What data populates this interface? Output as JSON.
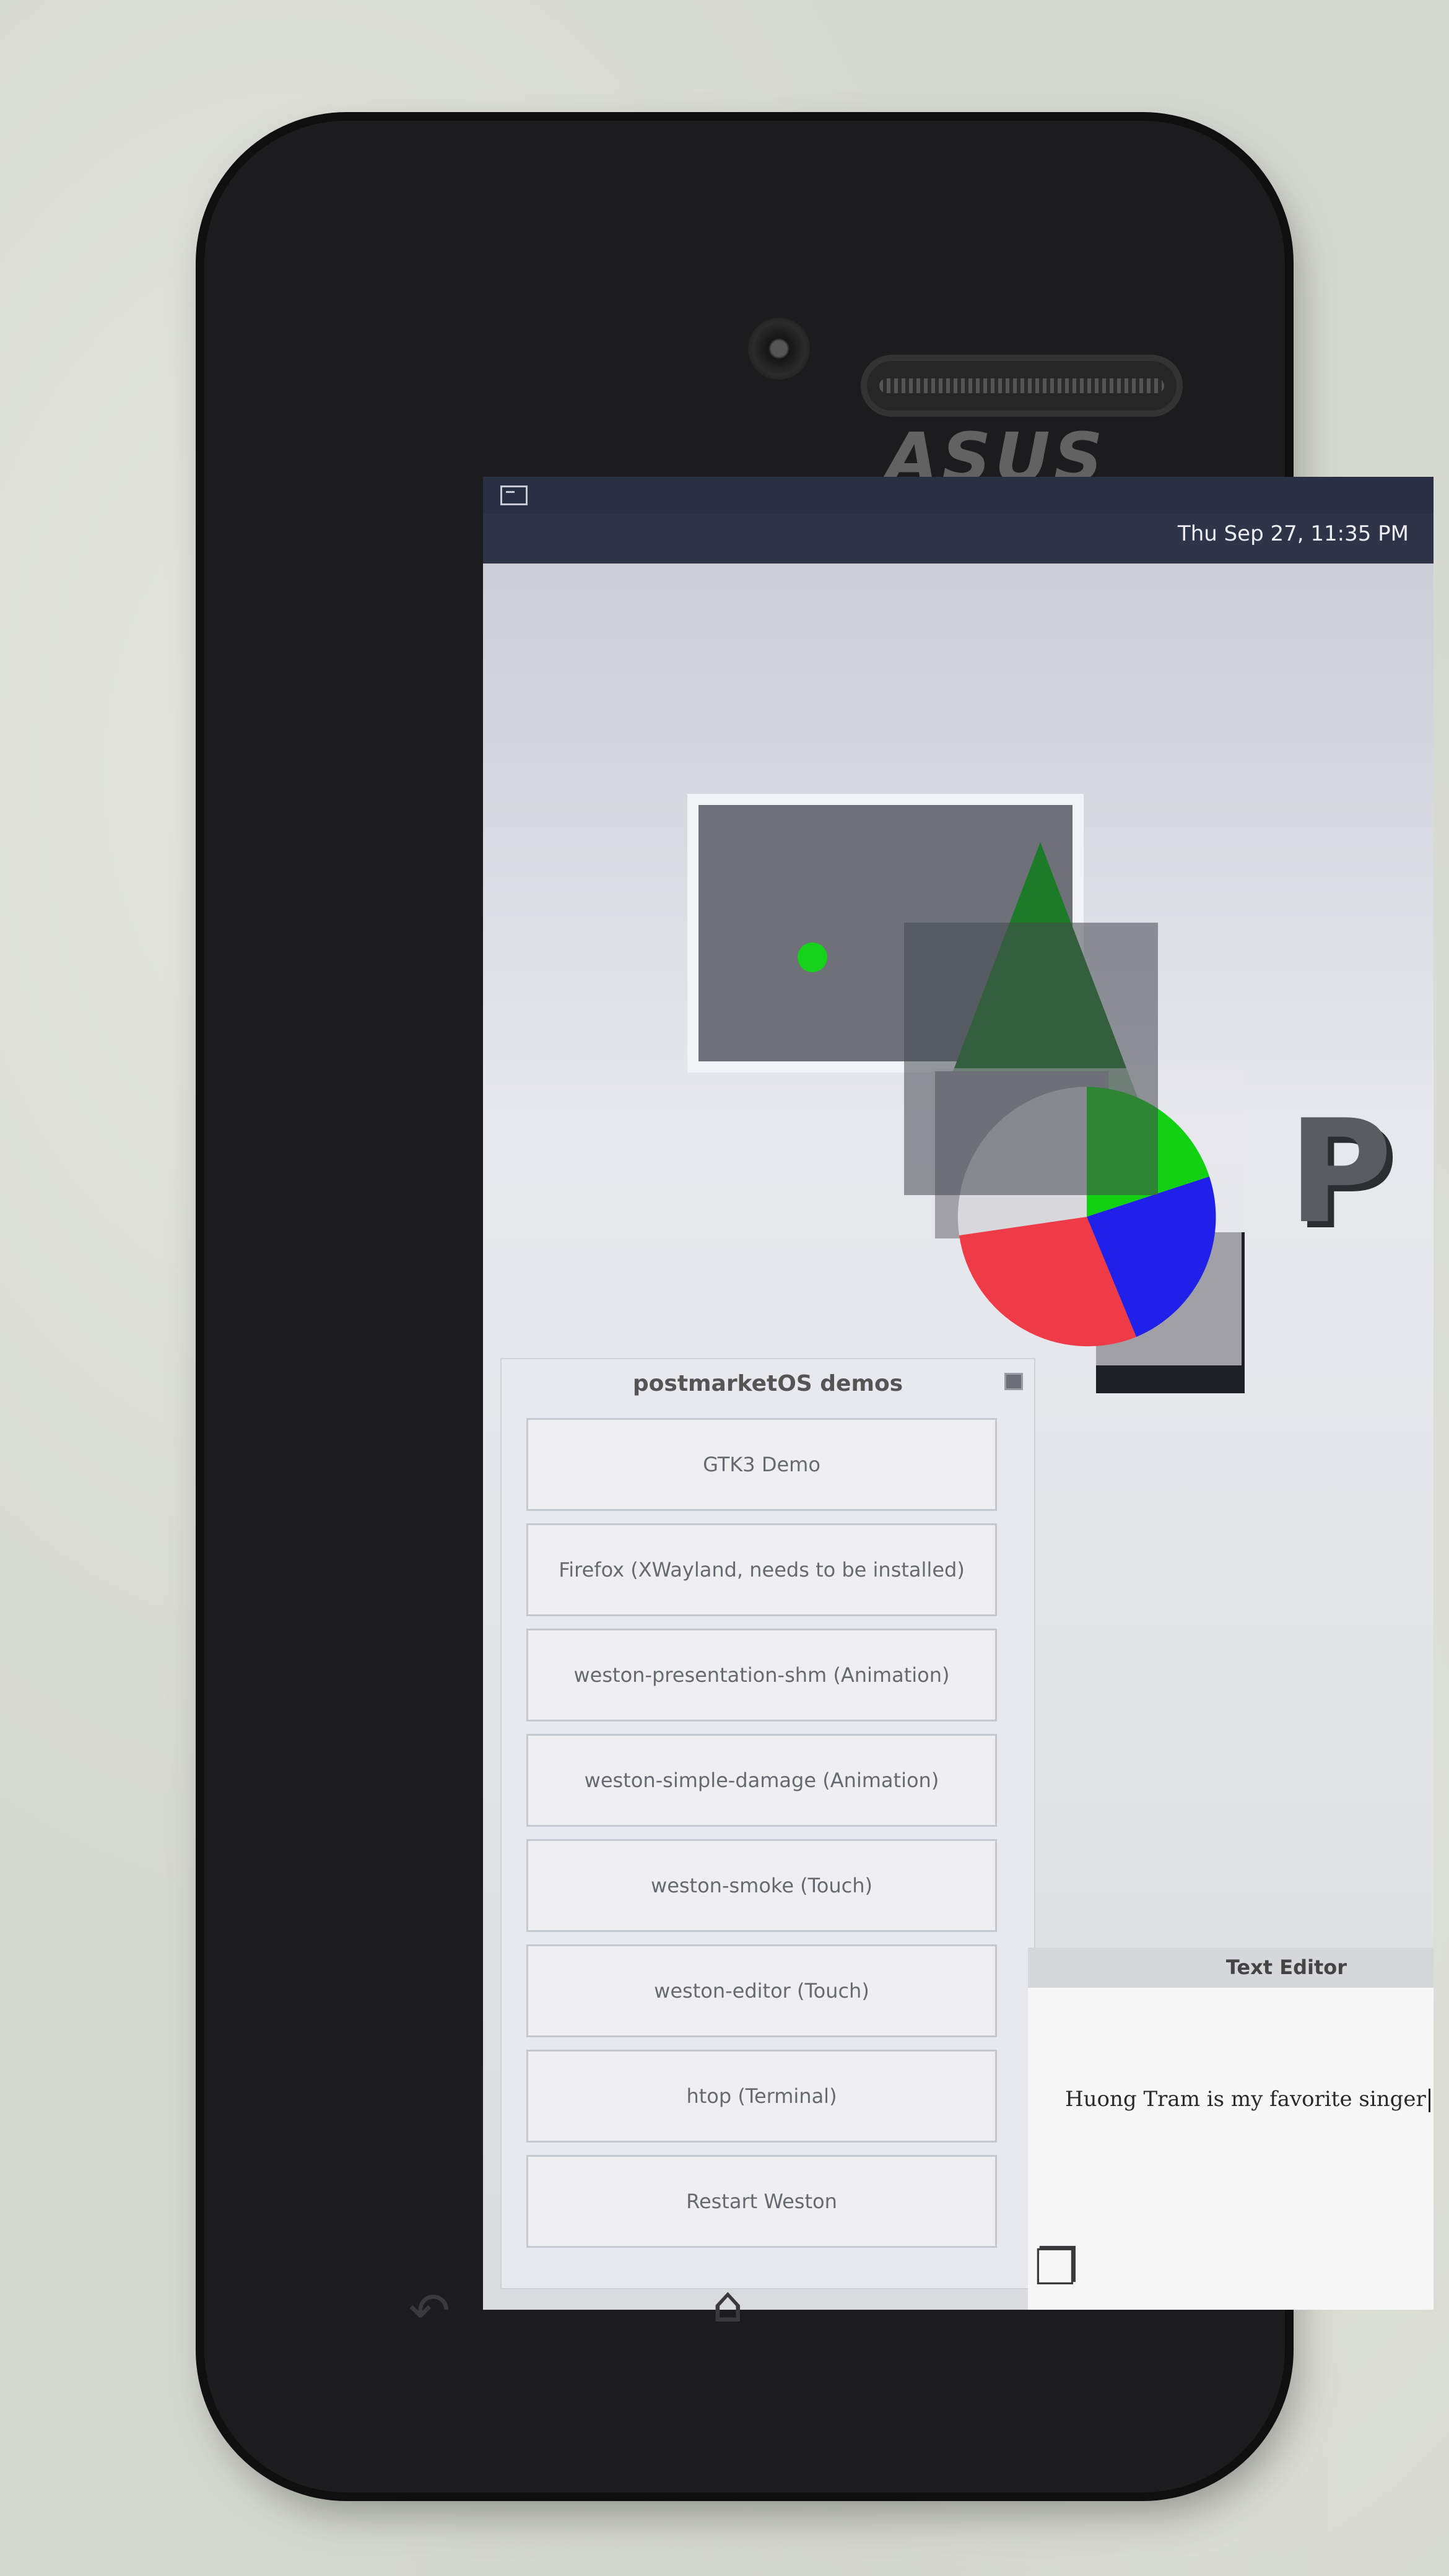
{
  "device": {
    "brand": "ASUS"
  },
  "status_bar": {
    "clock": "Thu Sep 27, 11:35 PM"
  },
  "background_logo": {
    "text": "P"
  },
  "demos_window": {
    "title": "postmarketOS demos",
    "buttons": [
      {
        "label": "GTK3 Demo"
      },
      {
        "label": "Firefox (XWayland, needs to be installed)"
      },
      {
        "label": "weston-presentation-shm (Animation)"
      },
      {
        "label": "weston-simple-damage (Animation)"
      },
      {
        "label": "weston-smoke (Touch)"
      },
      {
        "label": "weston-editor (Touch)"
      },
      {
        "label": "htop (Terminal)"
      },
      {
        "label": "Restart Weston"
      }
    ]
  },
  "text_editor": {
    "title": "Text Editor",
    "content": "Huong Tram is my favorite singer"
  },
  "colors": {
    "pie_green": "#12d012",
    "pie_blue": "#2020e8",
    "pie_red": "#ef3a48",
    "pie_light": "#d8d8dc",
    "dot_green": "#17d21a"
  },
  "icons": {
    "terminal": "terminal-icon",
    "close": "close-icon",
    "back": "back-icon",
    "home": "home-icon",
    "recents": "recents-icon"
  }
}
